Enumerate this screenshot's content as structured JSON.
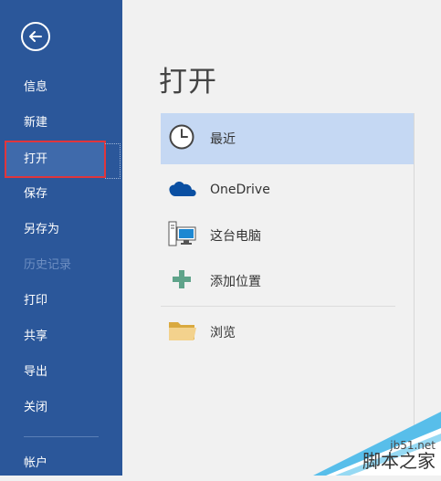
{
  "sidebar": {
    "back_icon": "back-arrow-icon",
    "items": [
      {
        "label": "信息",
        "state": "normal"
      },
      {
        "label": "新建",
        "state": "normal"
      },
      {
        "label": "打开",
        "state": "selected"
      },
      {
        "label": "保存",
        "state": "normal"
      },
      {
        "label": "另存为",
        "state": "normal"
      },
      {
        "label": "历史记录",
        "state": "disabled"
      },
      {
        "label": "打印",
        "state": "normal"
      },
      {
        "label": "共享",
        "state": "normal"
      },
      {
        "label": "导出",
        "state": "normal"
      },
      {
        "label": "关闭",
        "state": "normal"
      },
      {
        "label": "帐户",
        "state": "normal"
      }
    ]
  },
  "main": {
    "title": "打开",
    "locations": [
      {
        "label": "最近",
        "icon": "clock-icon",
        "active": true
      },
      {
        "label": "OneDrive",
        "icon": "cloud-icon",
        "active": false
      },
      {
        "label": "这台电脑",
        "icon": "computer-icon",
        "active": false
      },
      {
        "label": "添加位置",
        "icon": "plus-icon",
        "active": false
      },
      {
        "label": "浏览",
        "icon": "folder-icon",
        "active": false
      }
    ]
  },
  "watermark": {
    "url": "jb51.net",
    "text": "脚本之家"
  },
  "colors": {
    "sidebar_bg": "#2b579a",
    "selected_item_bg": "#3f6aab",
    "highlight_outline": "#e0363c",
    "active_location_bg": "#c5d8f3",
    "main_bg": "#f1f1f1",
    "onedrive_blue": "#0a4fa2",
    "plus_green": "#5fa38a",
    "folder_tan": "#e8c57e"
  }
}
